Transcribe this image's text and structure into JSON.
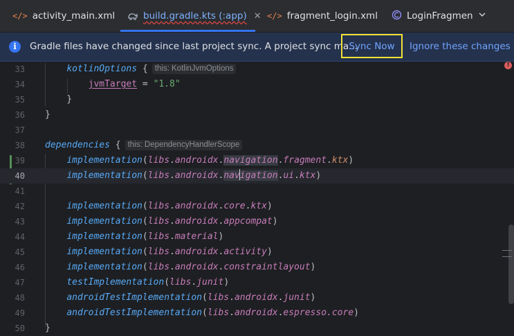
{
  "tabs": [
    {
      "label": "activity_main.xml",
      "icon": "xml-file-icon"
    },
    {
      "label": "build.gradle.kts (:app)",
      "icon": "gradle-file-icon"
    },
    {
      "label": "fragment_login.xml",
      "icon": "xml-file-icon"
    },
    {
      "label": "LoginFragmen",
      "icon": "kotlin-class-icon"
    }
  ],
  "notification": {
    "message": "Gradle files have changed since last project sync. A project sync ma...",
    "sync_label": "Sync Now",
    "ignore_label": "Ignore these changes"
  },
  "code": {
    "kotlin_options": "kotlinOptions",
    "hint_kotlin": "this: KotlinJvmOptions",
    "jvm_target": "jvmTarget",
    "eq": "=",
    "jvm_value": "\"1.8\"",
    "dependencies": "dependencies",
    "hint_deps": "this: DependencyHandlerScope",
    "impl": "implementation",
    "test_impl": "testImplementation",
    "android_test_impl": "androidTestImplementation",
    "libs": "libs",
    "androidx": "androidx",
    "navigation": "navigation",
    "nav_a": "nav",
    "nav_b": "igation",
    "fragment": "fragment",
    "ui": "ui",
    "ktx": "ktx",
    "core": "core",
    "appcompat": "appcompat",
    "material": "material",
    "activity": "activity",
    "constraintlayout": "constraintlayout",
    "junit": "junit",
    "espresso_core": "espresso.core"
  },
  "line_numbers": [
    "33",
    "34",
    "35",
    "36",
    "37",
    "38",
    "39",
    "40",
    "41",
    "42",
    "43",
    "44",
    "45",
    "46",
    "47",
    "48",
    "49",
    "50"
  ],
  "status": {
    "error_badge": "!"
  }
}
